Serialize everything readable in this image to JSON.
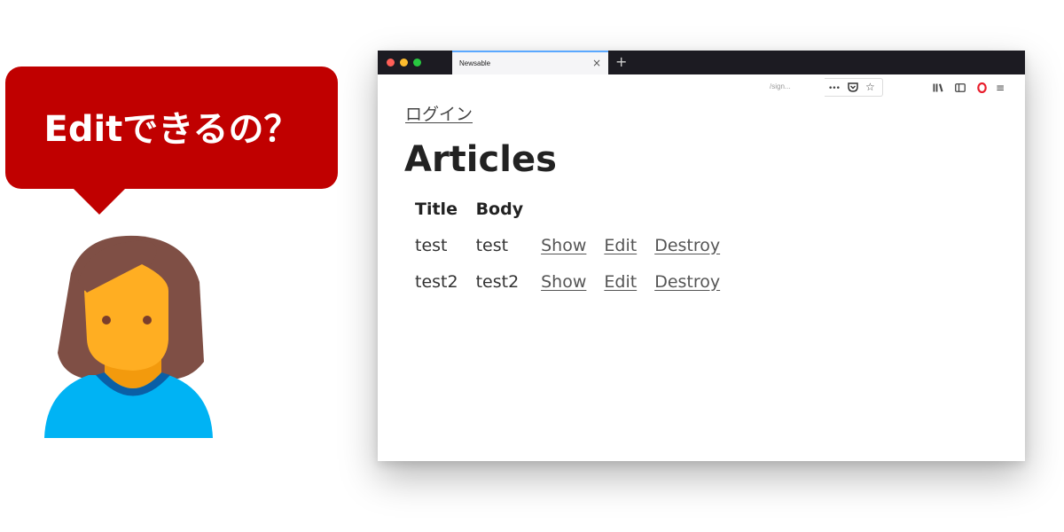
{
  "bubble": {
    "text": "Editできるの？",
    "color": "#c00000"
  },
  "browser": {
    "tab_title": "Newsable",
    "tab_close_icon": "×",
    "new_tab_icon": "+",
    "url_fragment": "/sign...",
    "toolbar_icons": [
      "ellipsis-icon",
      "pocket-icon",
      "star-icon",
      "library-icon",
      "sidebar-icon",
      "opera-icon",
      "menu-icon"
    ]
  },
  "page": {
    "login_link": "ログイン",
    "title": "Articles",
    "table": {
      "headers": [
        "Title",
        "Body"
      ],
      "rows": [
        {
          "title": "test",
          "body": "test",
          "show": "Show",
          "edit": "Edit",
          "destroy": "Destroy"
        },
        {
          "title": "test2",
          "body": "test2",
          "show": "Show",
          "edit": "Edit",
          "destroy": "Destroy"
        }
      ]
    }
  }
}
